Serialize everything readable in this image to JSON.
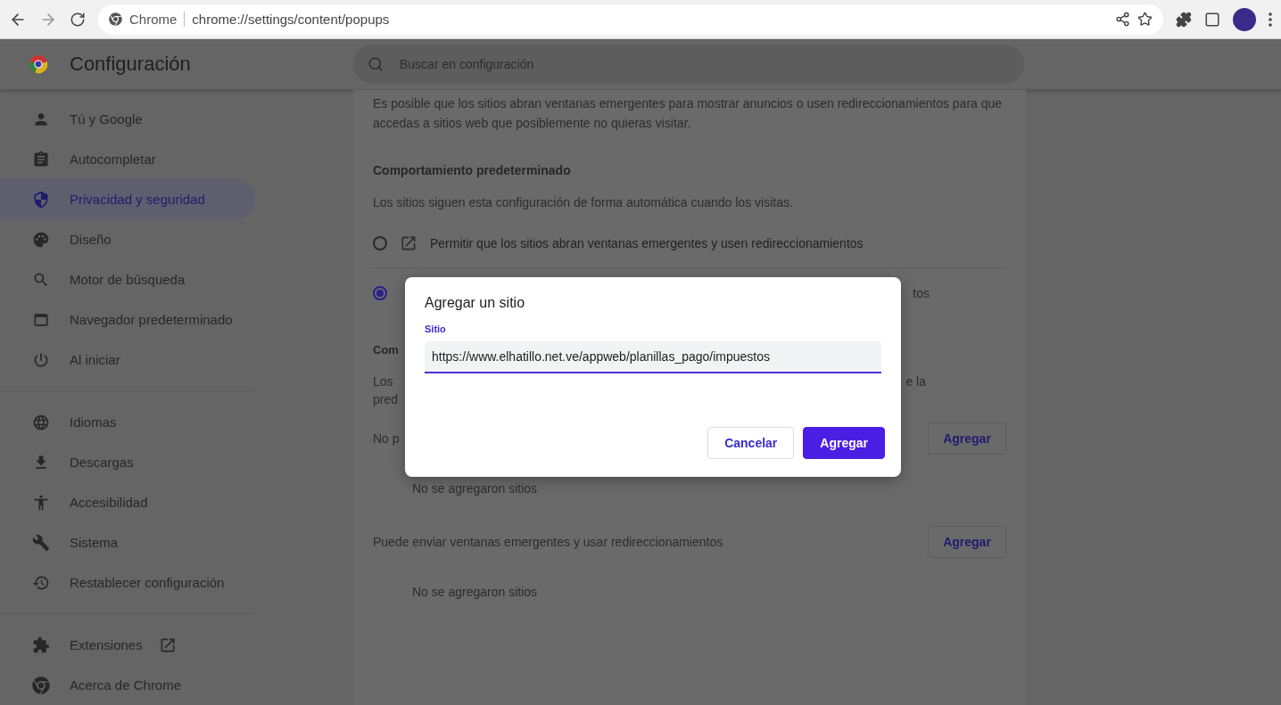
{
  "browser": {
    "omnibox": {
      "site_label": "Chrome",
      "url": "chrome://settings/content/popups"
    }
  },
  "header": {
    "title": "Configuración",
    "search": {
      "placeholder": "Buscar en configuración"
    }
  },
  "sidebar": {
    "groups": [
      {
        "items": [
          {
            "label": "Tú y Google",
            "selected": false
          },
          {
            "label": "Autocompletar",
            "selected": false
          },
          {
            "label": "Privacidad y seguridad",
            "selected": true
          },
          {
            "label": "Diseño",
            "selected": false
          },
          {
            "label": "Motor de búsqueda",
            "selected": false
          },
          {
            "label": "Navegador predeterminado",
            "selected": false
          },
          {
            "label": "Al iniciar",
            "selected": false
          }
        ]
      },
      {
        "items": [
          {
            "label": "Idiomas",
            "selected": false
          },
          {
            "label": "Descargas",
            "selected": false
          },
          {
            "label": "Accesibilidad",
            "selected": false
          },
          {
            "label": "Sistema",
            "selected": false
          },
          {
            "label": "Restablecer configuración",
            "selected": false
          }
        ]
      },
      {
        "items": [
          {
            "label": "Extensiones",
            "selected": false,
            "external": true
          },
          {
            "label": "Acerca de Chrome",
            "selected": false
          }
        ]
      }
    ]
  },
  "content": {
    "intro": "Es posible que los sitios abran ventanas emergentes para mostrar anuncios o usen redireccionamientos para que accedas a sitios web que posiblemente no quieras visitar.",
    "default_behavior": {
      "heading": "Comportamiento predeterminado",
      "description": "Los sitios siguen esta configuración de forma automática cuando los visitas.",
      "options": [
        {
          "label": "Permitir que los sitios abran ventanas emergentes y usen redireccionamientos",
          "selected": false
        },
        {
          "label": "tos",
          "selected": true
        }
      ]
    },
    "custom_behavior": {
      "heading": "Com",
      "description_left": [
        "Los",
        "pred"
      ],
      "description_right": "e la"
    },
    "site_lists": [
      {
        "title": "No p",
        "button": "Agregar",
        "empty": "No se agregaron sitios"
      },
      {
        "title": "Puede enviar ventanas emergentes y usar redireccionamientos",
        "button": "Agregar",
        "empty": "No se agregaron sitios"
      }
    ]
  },
  "dialog": {
    "title": "Agregar un sitio",
    "field": {
      "label": "Sitio",
      "value": "https://www.elhatillo.net.ve/appweb/planillas_pago/impuestos"
    },
    "buttons": [
      {
        "label": "Cancelar",
        "kind": "secondary"
      },
      {
        "label": "Agregar",
        "kind": "primary"
      }
    ]
  }
}
